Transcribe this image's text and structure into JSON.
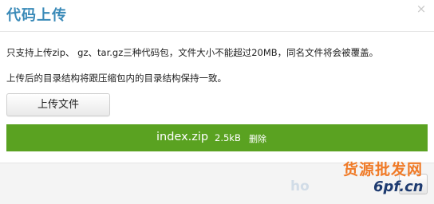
{
  "dialog": {
    "title": "代码上传",
    "close_glyph": "×",
    "info_line1": "只支持上传zip、 gz、tar.gz三种代码包，文件大小不能超过20MB，同名文件将会被覆盖。",
    "info_line2": "上传后的目录结构将跟压缩包内的目录结构保持一致。",
    "upload_button": "上传文件"
  },
  "file": {
    "name": "index.zip",
    "size": "2.5kB",
    "delete_label": "删除"
  },
  "watermark": {
    "line1": "货源批发网",
    "faded": "ho",
    "site": "6pf.cn"
  },
  "colors": {
    "title": "#3a8ab8",
    "file_bar": "#5aa221",
    "watermark_orange": "#f07b28",
    "watermark_navy": "#1e3b70"
  }
}
